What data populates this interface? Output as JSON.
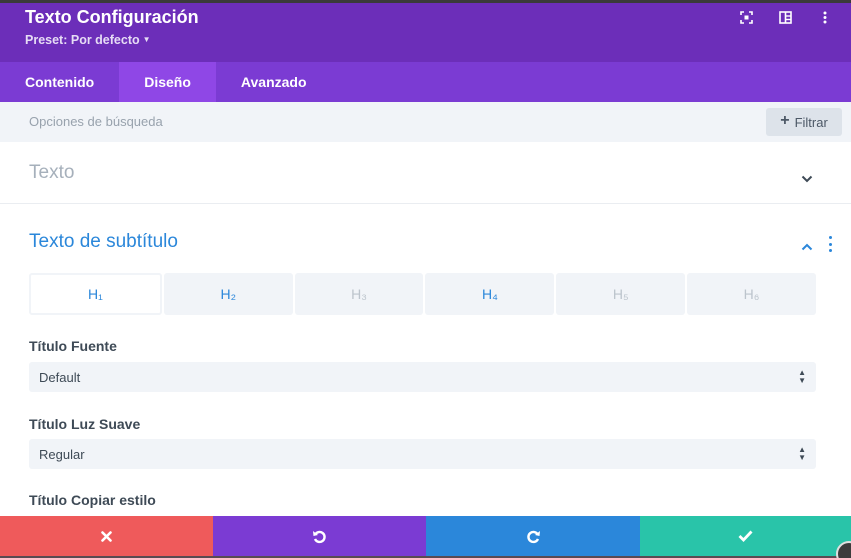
{
  "header": {
    "title": "Texto Configuración",
    "preset_label": "Preset: Por defecto",
    "icons": [
      "fullscreen-icon",
      "sidebar-layout-icon",
      "more-vertical-icon"
    ],
    "color": "#6c2eb9"
  },
  "tabs": [
    {
      "label": "Contenido",
      "active": false
    },
    {
      "label": "Diseño",
      "active": true
    },
    {
      "label": "Avanzado",
      "active": false
    }
  ],
  "search": {
    "placeholder": "Opciones de búsqueda",
    "filter_label": "Filtrar"
  },
  "sections": {
    "texto": {
      "title": "Texto",
      "expanded": false
    },
    "subtitulo": {
      "title": "Texto de subtítulo",
      "expanded": true
    }
  },
  "heading_tabs": [
    {
      "label": "H₁",
      "state": "active"
    },
    {
      "label": "H₂",
      "state": "set"
    },
    {
      "label": "H₃",
      "state": "default"
    },
    {
      "label": "H₄",
      "state": "set"
    },
    {
      "label": "H₅",
      "state": "default"
    },
    {
      "label": "H₆",
      "state": "default"
    }
  ],
  "fields": {
    "font": {
      "label": "Título Fuente",
      "value": "Default"
    },
    "weight": {
      "label": "Título Luz Suave",
      "value": "Regular"
    },
    "style": {
      "label": "Título Copiar estilo"
    }
  },
  "footer": {
    "buttons": [
      "cancel",
      "undo",
      "redo",
      "save"
    ],
    "colors": {
      "cancel": "#ef5a5b",
      "undo": "#7b3bd3",
      "redo": "#2b87da",
      "save": "#29c4a9"
    }
  },
  "colors": {
    "accent": "#2b87da",
    "tab_bar": "#7b3bd3",
    "tab_active": "#8f47e6"
  }
}
